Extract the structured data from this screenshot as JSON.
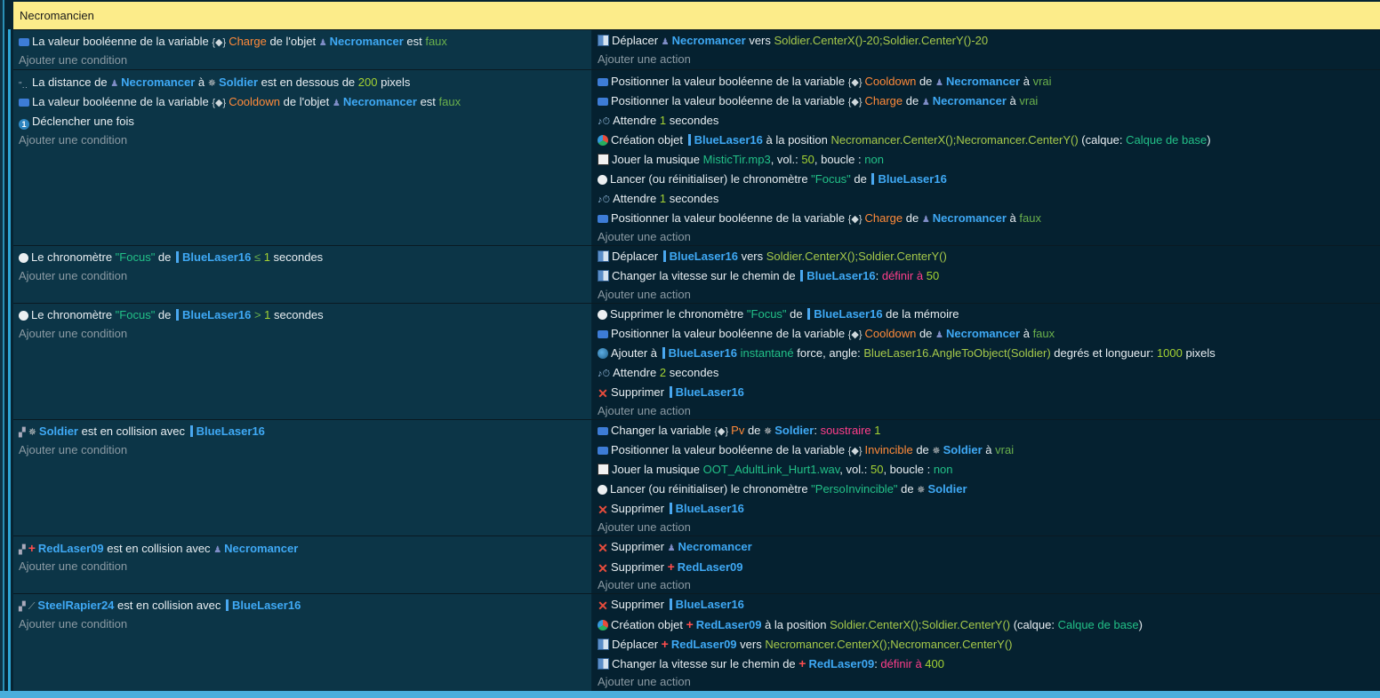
{
  "group": {
    "title": "Necromancien"
  },
  "common": {
    "add_condition": "Ajouter une condition",
    "add_action": "Ajouter une action"
  },
  "events": [
    {
      "conditions": [
        [
          "La valeur booléenne de la variable ",
          "Charge",
          " de l'objet ",
          "Necromancer",
          " est ",
          "faux"
        ]
      ],
      "actions": [
        [
          "Déplacer ",
          "Necromancer",
          " vers ",
          "Soldier.CenterX()-20;Soldier.CenterY()-20"
        ]
      ]
    },
    {
      "conditions": [
        [
          "La distance de ",
          "Necromancer",
          " à ",
          "Soldier",
          " est en dessous de ",
          "200",
          " pixels"
        ],
        [
          "La valeur booléenne de la variable ",
          "Cooldown",
          " de l'objet ",
          "Necromancer",
          " est ",
          "faux"
        ],
        [
          "Déclencher une fois"
        ]
      ],
      "actions": [
        [
          "Positionner la valeur booléenne de la variable ",
          "Cooldown",
          " de ",
          "Necromancer",
          " à ",
          "vrai"
        ],
        [
          "Positionner la valeur booléenne de la variable ",
          "Charge",
          " de ",
          "Necromancer",
          " à ",
          "vrai"
        ],
        [
          "Attendre ",
          "1",
          " secondes"
        ],
        [
          "Création objet ",
          "BlueLaser16",
          " à la position ",
          "Necromancer.CenterX();Necromancer.CenterY()",
          " (calque: ",
          "Calque de base",
          ")"
        ],
        [
          "Jouer la musique ",
          "MisticTir.mp3",
          ", vol.: ",
          "50",
          ", boucle : ",
          "non"
        ],
        [
          "Lancer (ou réinitialiser) le chronomètre ",
          "\"Focus\"",
          " de ",
          "BlueLaser16"
        ],
        [
          "Attendre ",
          "1",
          " secondes"
        ],
        [
          "Positionner la valeur booléenne de la variable ",
          "Charge",
          " de ",
          "Necromancer",
          " à ",
          "faux"
        ]
      ]
    },
    {
      "conditions": [
        [
          "Le chronomètre ",
          "\"Focus\"",
          " de ",
          "BlueLaser16",
          " ≤ ",
          "1",
          " secondes"
        ]
      ],
      "actions": [
        [
          "Déplacer ",
          "BlueLaser16",
          " vers ",
          "Soldier.CenterX();Soldier.CenterY()"
        ],
        [
          "Changer la vitesse sur le chemin de ",
          "BlueLaser16",
          ": ",
          "définir à",
          " ",
          "50"
        ]
      ]
    },
    {
      "conditions": [
        [
          "Le chronomètre ",
          "\"Focus\"",
          " de ",
          "BlueLaser16",
          " > ",
          "1",
          " secondes"
        ]
      ],
      "actions": [
        [
          "Supprimer le chronomètre ",
          "\"Focus\"",
          " de ",
          "BlueLaser16",
          " de la mémoire"
        ],
        [
          "Positionner la valeur booléenne de la variable ",
          "Cooldown",
          " de ",
          "Necromancer",
          " à ",
          "faux"
        ],
        [
          "Ajouter à ",
          "BlueLaser16",
          " ",
          "instantané",
          " force, angle: ",
          "BlueLaser16.AngleToObject(Soldier)",
          " degrés et longueur: ",
          "1000",
          " pixels"
        ],
        [
          "Attendre ",
          "2",
          " secondes"
        ],
        [
          "Supprimer ",
          "BlueLaser16"
        ]
      ]
    },
    {
      "conditions": [
        [
          "Soldier",
          " est en collision avec ",
          "BlueLaser16"
        ]
      ],
      "actions": [
        [
          "Changer la variable ",
          "Pv",
          " de ",
          "Soldier",
          ": ",
          "soustraire",
          " ",
          "1"
        ],
        [
          "Positionner la valeur booléenne de la variable ",
          "Invincible",
          " de ",
          "Soldier",
          " à ",
          "vrai"
        ],
        [
          "Jouer la musique ",
          "OOT_AdultLink_Hurt1.wav",
          ", vol.: ",
          "50",
          ", boucle : ",
          "non"
        ],
        [
          "Lancer (ou réinitialiser) le chronomètre ",
          "\"PersoInvincible\"",
          " de ",
          "Soldier"
        ],
        [
          "Supprimer ",
          "BlueLaser16"
        ]
      ]
    },
    {
      "conditions": [
        [
          "RedLaser09",
          " est en collision avec ",
          "Necromancer"
        ]
      ],
      "actions": [
        [
          "Supprimer ",
          "Necromancer"
        ],
        [
          "Supprimer ",
          "RedLaser09"
        ]
      ]
    },
    {
      "conditions": [
        [
          "SteelRapier24",
          " est en collision avec ",
          "BlueLaser16"
        ]
      ],
      "actions": [
        [
          "Supprimer ",
          "BlueLaser16"
        ],
        [
          "Création objet ",
          "RedLaser09",
          " à la position ",
          "Soldier.CenterX();Soldier.CenterY()",
          " (calque: ",
          "Calque de base",
          ")"
        ],
        [
          "Déplacer ",
          "RedLaser09",
          " vers ",
          "Necromancer.CenterX();Necromancer.CenterY()"
        ],
        [
          "Changer la vitesse sur le chemin de ",
          "RedLaser09",
          ": ",
          "définir à",
          " ",
          "400"
        ]
      ]
    }
  ]
}
